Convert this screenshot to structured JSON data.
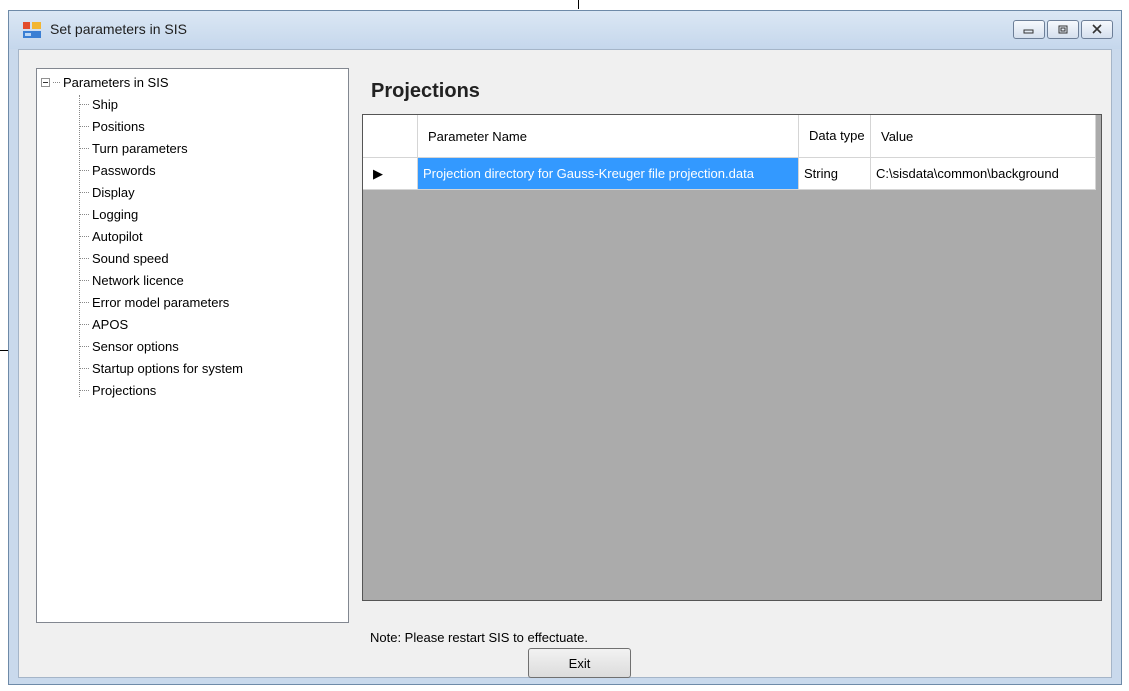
{
  "window": {
    "title": "Set parameters in SIS"
  },
  "tree": {
    "root_label": "Parameters in SIS",
    "items": [
      {
        "label": "Ship"
      },
      {
        "label": "Positions"
      },
      {
        "label": "Turn parameters"
      },
      {
        "label": "Passwords"
      },
      {
        "label": "Display"
      },
      {
        "label": "Logging"
      },
      {
        "label": "Autopilot"
      },
      {
        "label": "Sound speed"
      },
      {
        "label": "Network licence"
      },
      {
        "label": "Error model parameters"
      },
      {
        "label": "APOS"
      },
      {
        "label": "Sensor options"
      },
      {
        "label": "Startup options for system"
      },
      {
        "label": "Projections"
      }
    ]
  },
  "main": {
    "heading": "Projections",
    "grid": {
      "columns": {
        "name": "Parameter Name",
        "dtype": "Data type",
        "value": "Value"
      },
      "rows": [
        {
          "indicator": "▶",
          "name": "Projection directory for Gauss-Kreuger file projection.data",
          "dtype": "String",
          "value": "C:\\sisdata\\common\\background"
        }
      ]
    },
    "note": "Note: Please restart SIS to effectuate.",
    "exit_label": "Exit"
  },
  "colors": {
    "selection": "#3399ff",
    "grid_background": "#ababab",
    "client_background": "#f0f0f0"
  }
}
